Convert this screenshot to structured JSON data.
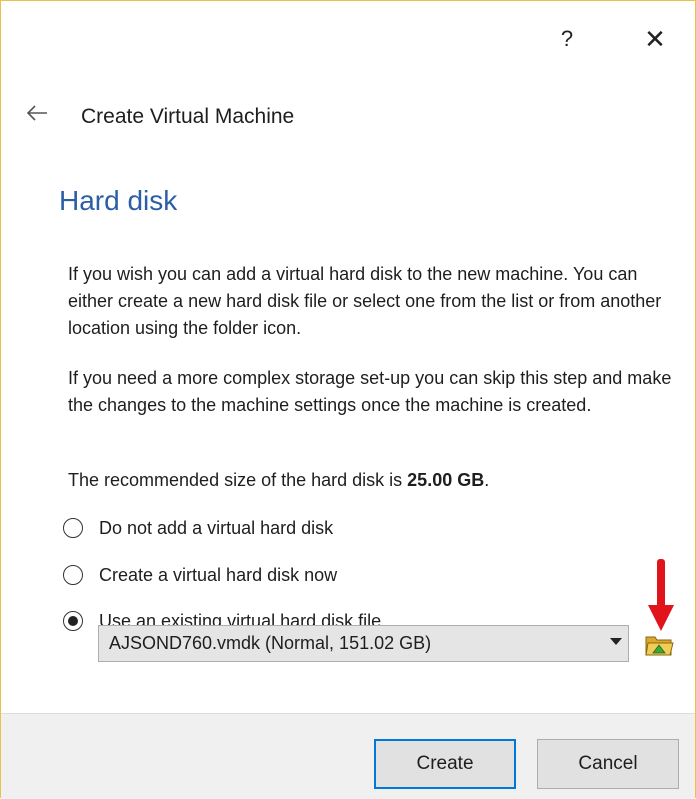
{
  "window": {
    "help_label": "?",
    "close_label": "✕"
  },
  "wizard": {
    "title": "Create Virtual Machine",
    "back_icon": "arrow-left-icon"
  },
  "page": {
    "heading": "Hard disk",
    "paragraph1": "If you wish you can add a virtual hard disk to the new machine. You can either create a new hard disk file or select one from the list or from another location using the folder icon.",
    "paragraph2": "If you need a more complex storage set-up you can skip this step and make the changes to the machine settings once the machine is created.",
    "recommended_prefix": "The recommended size of the hard disk is ",
    "recommended_size": "25.00 GB",
    "recommended_suffix": "."
  },
  "options": [
    {
      "label": "Do not add a virtual hard disk",
      "selected": false
    },
    {
      "label": "Create a virtual hard disk now",
      "selected": false
    },
    {
      "label": "Use an existing virtual hard disk file",
      "selected": true
    }
  ],
  "disk_select": {
    "value": "AJSOND760.vmdk (Normal, 151.02 GB)",
    "folder_icon": "folder-open-icon"
  },
  "annotation": {
    "arrow_color": "#e0141a"
  },
  "buttons": {
    "create": "Create",
    "cancel": "Cancel"
  },
  "colors": {
    "heading": "#2b5ea5",
    "focus_border": "#0078d7",
    "footer_bg": "#f0f0f0"
  }
}
